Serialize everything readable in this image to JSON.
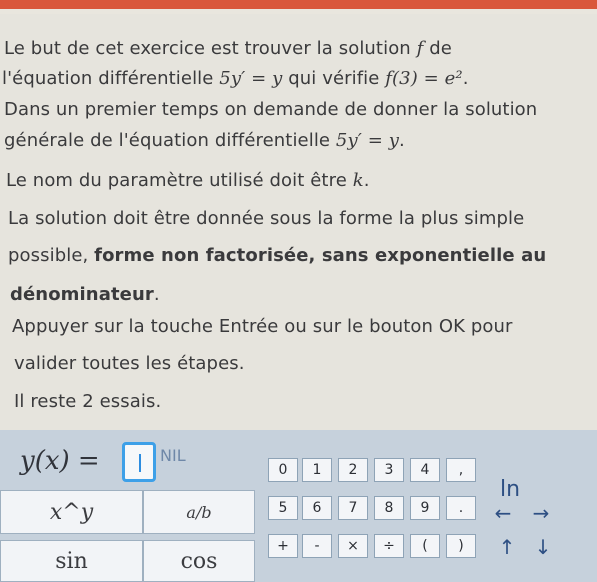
{
  "text": {
    "line1_a": "Le but de cet exercice est trouver la solution",
    "line1_f": "f",
    "line1_b": "de",
    "line2_a": "l'équation différentielle",
    "line2_eq": "5y′ = y",
    "line2_b": "qui vérifie",
    "line2_cond": "f(3) = e²",
    "line2_end": ".",
    "line3": "Dans un premier temps on demande de donner la solution",
    "line4_a": "générale de l'équation différentielle",
    "line4_eq": "5y′ = y",
    "line4_end": ".",
    "line5_a": "Le nom du paramètre utilisé doit être",
    "line5_k": "k",
    "line5_end": ".",
    "line6": "La solution doit être donnée sous la forme la plus simple",
    "line7_a": "possible,",
    "line7_b": "forme non factorisée, sans exponentielle au",
    "line8": "dénominateur",
    "line8_end": ".",
    "line9": "Appuyer sur la touche Entrée ou sur le bouton OK pour",
    "line10": "valider toutes les étapes.",
    "line11": "Il reste 2 essais."
  },
  "answer": {
    "lhs": "y(x) =",
    "value": "",
    "hint": "NIL"
  },
  "keypad": {
    "big": [
      "x^y",
      "a/b",
      "sin",
      "cos"
    ],
    "row1": [
      "0",
      "1",
      "2",
      "3",
      "4",
      ","
    ],
    "row2": [
      "5",
      "6",
      "7",
      "8",
      "9",
      "."
    ],
    "row3": [
      "+",
      "-",
      "×",
      "÷",
      "(",
      ")"
    ],
    "side": [
      "ln",
      "←",
      "→",
      "↑",
      "↓"
    ]
  }
}
